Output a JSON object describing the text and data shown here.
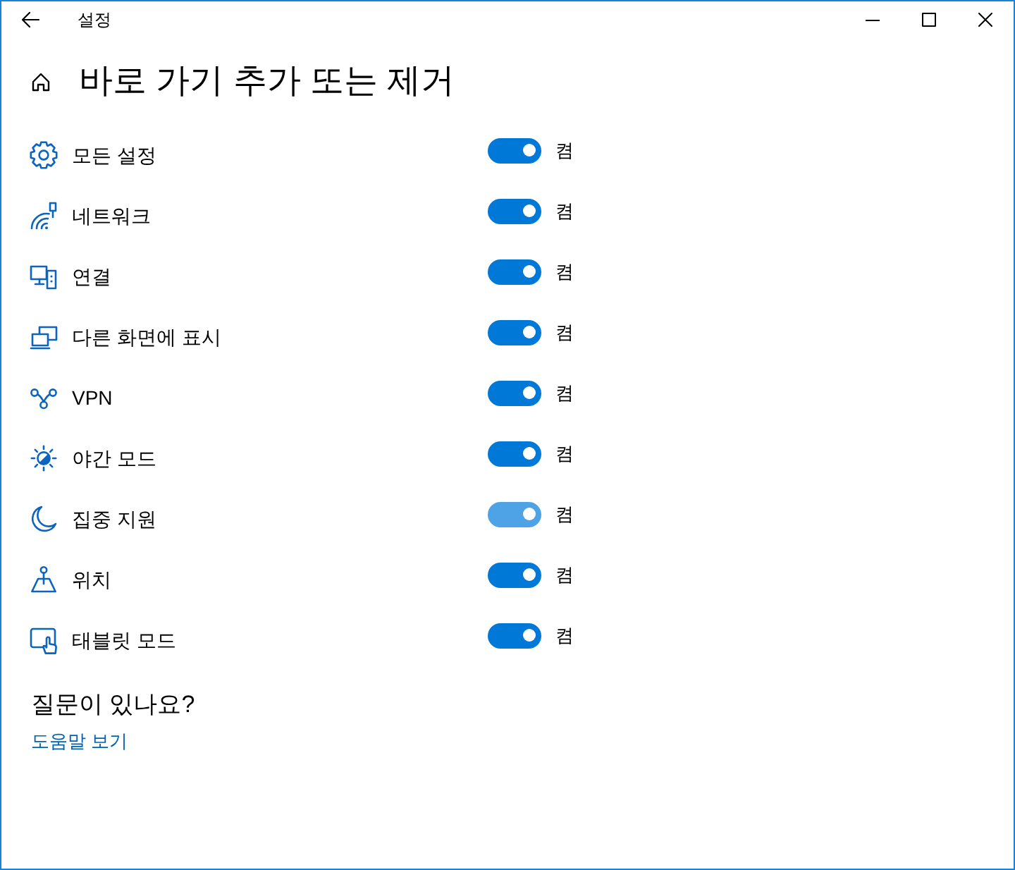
{
  "window": {
    "title": "설정"
  },
  "header": {
    "title": "바로 가기 추가 또는 제거"
  },
  "items": [
    {
      "label": "모든 설정",
      "on": true,
      "hovered": false,
      "state_label": "켬"
    },
    {
      "label": "네트워크",
      "on": true,
      "hovered": false,
      "state_label": "켬"
    },
    {
      "label": "연결",
      "on": true,
      "hovered": false,
      "state_label": "켬"
    },
    {
      "label": "다른 화면에 표시",
      "on": true,
      "hovered": false,
      "state_label": "켬"
    },
    {
      "label": "VPN",
      "on": true,
      "hovered": false,
      "state_label": "켬"
    },
    {
      "label": "야간 모드",
      "on": true,
      "hovered": false,
      "state_label": "켬"
    },
    {
      "label": "집중 지원",
      "on": true,
      "hovered": true,
      "state_label": "켬"
    },
    {
      "label": "위치",
      "on": true,
      "hovered": false,
      "state_label": "켬"
    },
    {
      "label": "태블릿 모드",
      "on": true,
      "hovered": false,
      "state_label": "켬"
    }
  ],
  "help": {
    "question": "질문이 있나요?",
    "link": "도움말 보기"
  }
}
